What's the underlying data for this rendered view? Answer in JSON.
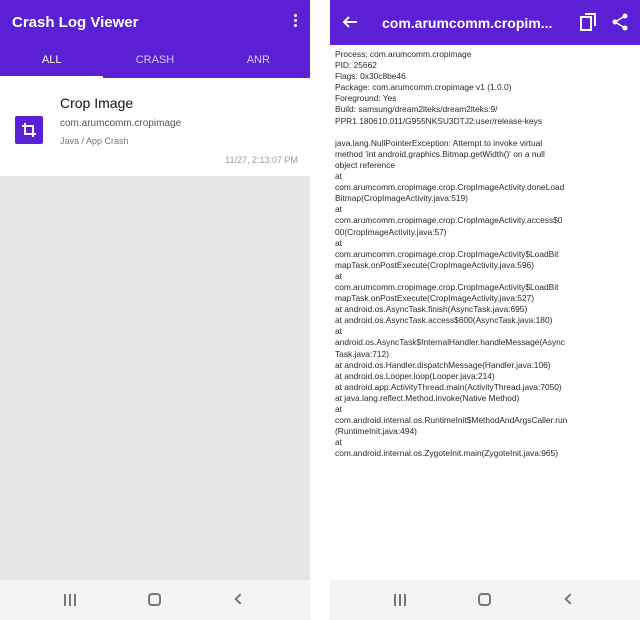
{
  "left": {
    "app_title": "Crash Log Viewer",
    "tabs": [
      {
        "label": "ALL",
        "active": true
      },
      {
        "label": "CRASH",
        "active": false
      },
      {
        "label": "ANR",
        "active": false
      }
    ],
    "crash": {
      "title": "Crop Image",
      "package": "com.arumcomm.cropimage",
      "type": "Java / App Crash",
      "time": "11/27, 2:13:07 PM"
    }
  },
  "right": {
    "title": "com.arumcomm.cropim...",
    "log_lines": [
      "Process: com.arumcomm.cropimage",
      "PID: 25662",
      "Flags: 0x30c8be46",
      "Package: com.arumcomm.cropimage v1 (1.0.0)",
      "Foreground: Yes",
      "Build: samsung/dream2lteks/dream2lteks:9/",
      "PPR1.180610.011/G955NKSU3DTJ2:user/release-keys",
      "",
      "java.lang.NullPointerException: Attempt to invoke virtual",
      "method 'int android.graphics.Bitmap.getWidth()' on a null",
      "object reference",
      "  at",
      "com.arumcomm.cropimage.crop.CropImageActivity.doneLoad",
      "Bitmap(CropImageActivity.java:519)",
      "  at",
      "com.arumcomm.cropimage.crop.CropImageActivity.access$0",
      "00(CropImageActivity.java:57)",
      "  at",
      "com.arumcomm.cropimage.crop.CropImageActivity$LoadBit",
      "mapTask.onPostExecute(CropImageActivity.java:596)",
      "  at",
      "com.arumcomm.cropimage.crop.CropImageActivity$LoadBit",
      "mapTask.onPostExecute(CropImageActivity.java:527)",
      "  at android.os.AsyncTask.finish(AsyncTask.java:695)",
      "  at android.os.AsyncTask.access$600(AsyncTask.java:180)",
      "  at",
      "android.os.AsyncTask$InternalHandler.handleMessage(Async",
      "Task.java:712)",
      "  at android.os.Handler.dispatchMessage(Handler.java:106)",
      "  at android.os.Looper.loop(Looper.java:214)",
      "  at android.app.ActivityThread.main(ActivityThread.java:7050)",
      "  at java.lang.reflect.Method.invoke(Native Method)",
      "  at",
      "com.android.internal.os.RuntimeInit$MethodAndArgsCaller.run",
      "(RuntimeInit.java:494)",
      "  at",
      "com.android.internal.os.ZygoteInit.main(ZygoteInit.java:965)"
    ]
  },
  "colors": {
    "primary": "#5b1fd6",
    "background_empty": "#e6e6e6",
    "navbar": "#f4f4f4"
  },
  "icons": [
    "overflow-menu-icon",
    "crop-icon",
    "back-arrow-icon",
    "copy-icon",
    "share-icon",
    "nav-recents-icon",
    "nav-home-icon",
    "nav-back-icon"
  ]
}
